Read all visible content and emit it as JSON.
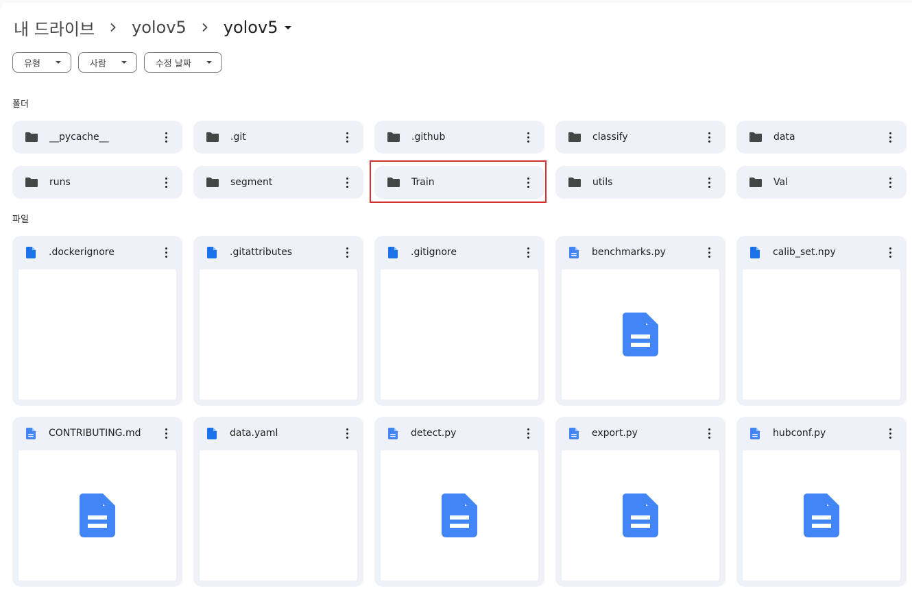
{
  "breadcrumb": {
    "root": "내 드라이브",
    "parent": "yolov5",
    "current": "yolov5"
  },
  "filters": [
    {
      "label": "유형"
    },
    {
      "label": "사람"
    },
    {
      "label": "수정 날짜"
    }
  ],
  "sections": {
    "folders_label": "폴더",
    "files_label": "파일"
  },
  "folders": [
    {
      "name": "__pycache__"
    },
    {
      "name": ".git"
    },
    {
      "name": ".github"
    },
    {
      "name": "classify"
    },
    {
      "name": "data"
    },
    {
      "name": "runs"
    },
    {
      "name": "segment"
    },
    {
      "name": "Train",
      "highlighted": true
    },
    {
      "name": "utils"
    },
    {
      "name": "Val"
    }
  ],
  "files": [
    {
      "name": ".dockerignore",
      "preview": "blank",
      "icon": "file-icon"
    },
    {
      "name": ".gitattributes",
      "preview": "blank",
      "icon": "file-icon"
    },
    {
      "name": ".gitignore",
      "preview": "blank",
      "icon": "file-icon"
    },
    {
      "name": "benchmarks.py",
      "preview": "doc-icon",
      "icon": "doc-icon"
    },
    {
      "name": "calib_set.npy",
      "preview": "blank",
      "icon": "file-icon"
    },
    {
      "name": "CONTRIBUTING.md",
      "preview": "doc-icon",
      "icon": "doc-icon"
    },
    {
      "name": "data.yaml",
      "preview": "blank",
      "icon": "file-icon"
    },
    {
      "name": "detect.py",
      "preview": "doc-icon",
      "icon": "doc-icon"
    },
    {
      "name": "export.py",
      "preview": "doc-icon",
      "icon": "doc-icon"
    },
    {
      "name": "hubconf.py",
      "preview": "doc-icon",
      "icon": "doc-icon"
    }
  ],
  "colors": {
    "card_bg": "#eef2f8",
    "icon_blue": "#4285f4",
    "highlight": "#d32f2f"
  }
}
